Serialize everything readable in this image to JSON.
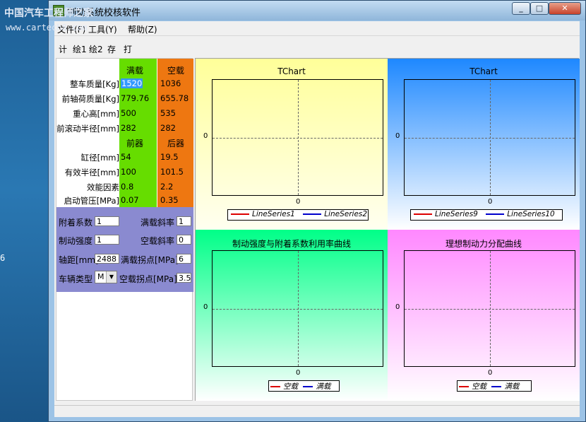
{
  "window": {
    "title": "制动系统校核软件",
    "watermark_line1": "中国汽车工程师之家",
    "watermark_line2": "www.cartech8.com"
  },
  "desktop": {
    "left_label": "6"
  },
  "menu": {
    "items": [
      "文件(F)",
      "工具(Y)",
      "帮助(Z)"
    ]
  },
  "toolbar": {
    "items": [
      "计",
      "绘1",
      "绘2",
      "存",
      "打"
    ]
  },
  "vehicle_table": {
    "col_full": "满载",
    "col_empty": "空载",
    "rows": [
      {
        "label": "整车质量[Kg]",
        "full": "1520",
        "empty": "1036"
      },
      {
        "label": "前轴荷质量[Kg]",
        "full": "779.76",
        "empty": "655.78"
      },
      {
        "label": "重心高[mm]",
        "full": "500",
        "empty": "535"
      },
      {
        "label": "前滚动半径[mm]",
        "full": "282",
        "empty": "282"
      }
    ],
    "col_front": "前器",
    "col_rear": "后器",
    "rows2": [
      {
        "label": "缸径[mm]",
        "front": "54",
        "rear": "19.5"
      },
      {
        "label": "有效半径[mm]",
        "front": "100",
        "rear": "101.5"
      },
      {
        "label": "效能因素",
        "front": "0.8",
        "rear": "2.2"
      },
      {
        "label": "启动管压[MPa]",
        "front": "0.07",
        "rear": "0.35"
      }
    ]
  },
  "params": {
    "adhesion_label": "附着系数",
    "adhesion_value": "1",
    "full_slope_label": "满载斜率",
    "full_slope_value": "1",
    "brake_strength_label": "制动强度",
    "brake_strength_value": "1",
    "empty_slope_label": "空载斜率",
    "empty_slope_value": "0",
    "wheelbase_label": "轴距[mm]",
    "wheelbase_value": "2488",
    "full_knee_label": "满载拐点[MPa]",
    "full_knee_value": "6",
    "vehicle_type_label": "车辆类型",
    "vehicle_type_value": "M",
    "empty_knee_label": "空载拐点[MPa]",
    "empty_knee_value": "3.5"
  },
  "charts": [
    {
      "title": "TChart",
      "y0": "0",
      "x0": "0",
      "legend": [
        {
          "name": "LineSeries1",
          "color": "#dd0000"
        },
        {
          "name": "LineSeries2",
          "color": "#0000cc"
        }
      ]
    },
    {
      "title": "TChart",
      "y0": "0",
      "x0": "0",
      "legend": [
        {
          "name": "LineSeries9",
          "color": "#dd0000"
        },
        {
          "name": "LineSeries10",
          "color": "#0000cc"
        }
      ]
    },
    {
      "title": "制动强度与附着系数利用率曲线",
      "y0": "0",
      "x0": "0",
      "legend": [
        {
          "name": "空载",
          "color": "#dd0000"
        },
        {
          "name": "满载",
          "color": "#0000cc"
        }
      ]
    },
    {
      "title": "理想制动力分配曲线",
      "y0": "0",
      "x0": "0",
      "legend": [
        {
          "name": "空载",
          "color": "#dd0000"
        },
        {
          "name": "满载",
          "color": "#0000cc"
        }
      ]
    }
  ]
}
